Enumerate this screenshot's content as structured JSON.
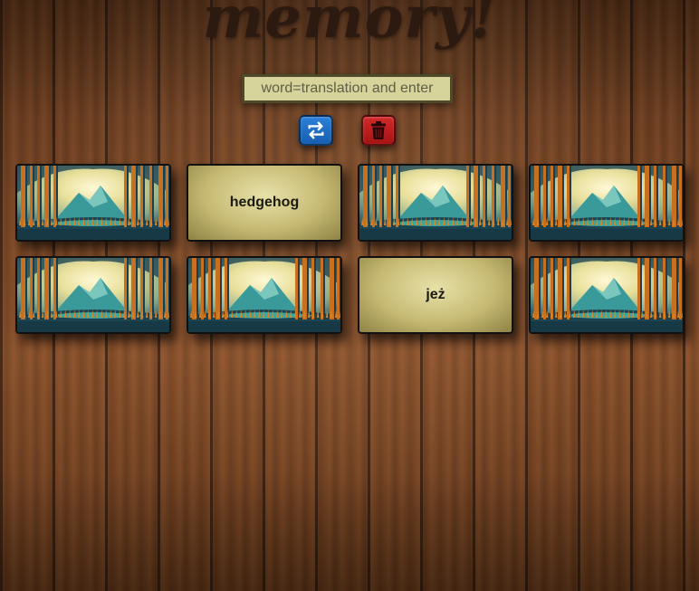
{
  "app": {
    "title": "memory!"
  },
  "input": {
    "placeholder": "word=translation and enter",
    "value": ""
  },
  "toolbar": {
    "shuffle_icon": "shuffle-icon",
    "delete_icon": "trash-icon",
    "shuffle_color": "#1f6fc8",
    "delete_color": "#c21b1b"
  },
  "cards": [
    {
      "state": "face-down",
      "text": ""
    },
    {
      "state": "face-up",
      "text": "hedgehog"
    },
    {
      "state": "face-down",
      "text": ""
    },
    {
      "state": "face-down",
      "text": ""
    },
    {
      "state": "face-down",
      "text": ""
    },
    {
      "state": "face-down",
      "text": ""
    },
    {
      "state": "face-up",
      "text": "jeż"
    },
    {
      "state": "face-down",
      "text": ""
    }
  ]
}
